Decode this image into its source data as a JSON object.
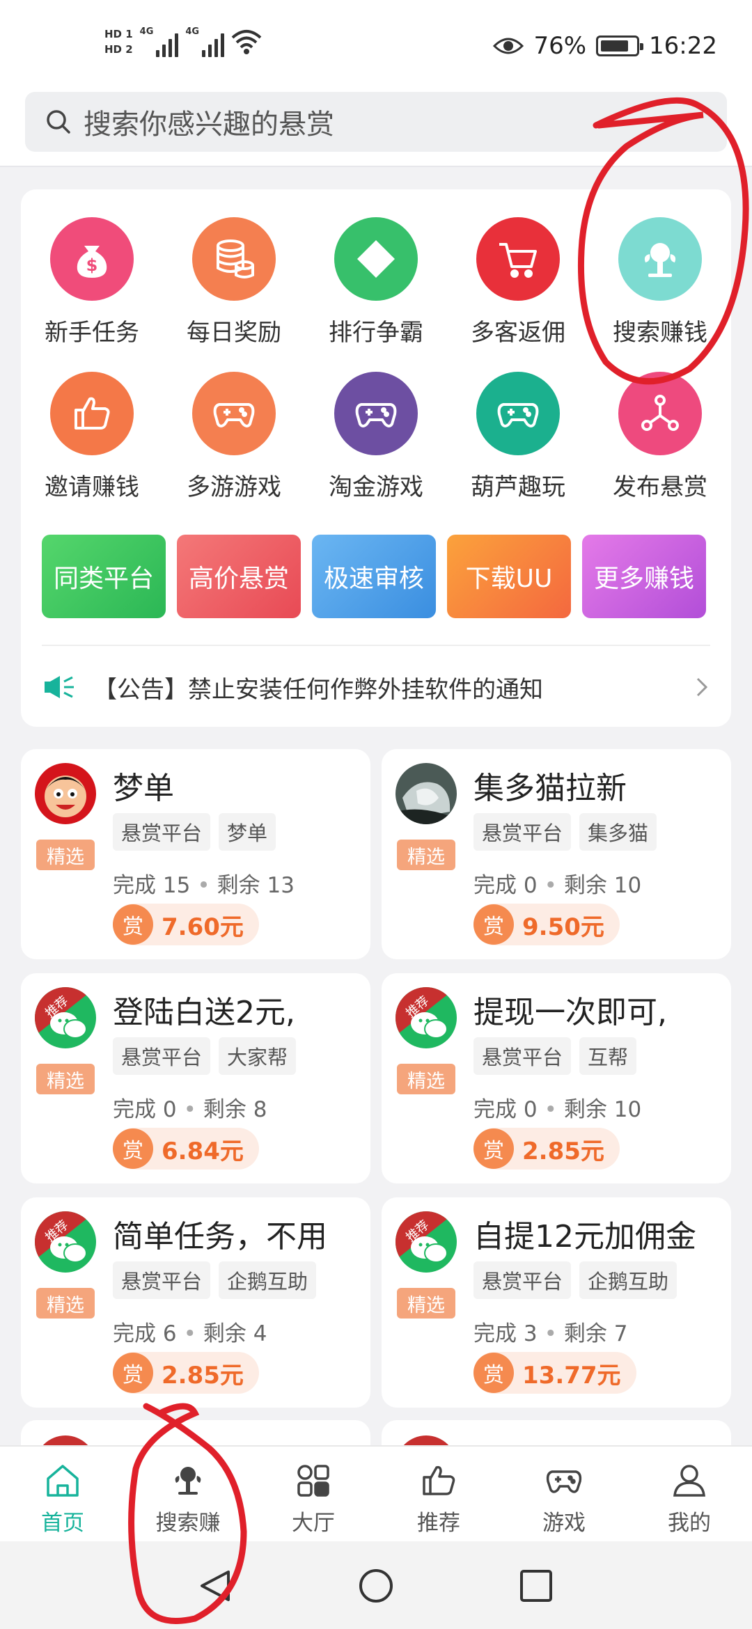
{
  "status_bar": {
    "hd1": "HD 1",
    "hd2": "HD 2",
    "net1": "4G",
    "net2": "4G",
    "battery": "76%",
    "time": "16:22"
  },
  "search": {
    "placeholder": "搜索你感兴趣的悬赏"
  },
  "quick_actions": [
    {
      "label": "新手任务",
      "icon": "money-bag-icon",
      "color": "#f04c7a"
    },
    {
      "label": "每日奖励",
      "icon": "coins-stack-icon",
      "color": "#f47f50"
    },
    {
      "label": "排行争霸",
      "icon": "diamond-icon",
      "color": "#37c06b"
    },
    {
      "label": "多客返佣",
      "icon": "shopping-cart-icon",
      "color": "#e8303a"
    },
    {
      "label": "搜索赚钱",
      "icon": "search-money-icon",
      "color": "#7ddbd1"
    },
    {
      "label": "邀请赚钱",
      "icon": "thumbs-up-icon",
      "color": "#f47848"
    },
    {
      "label": "多游游戏",
      "icon": "gamepad-icon",
      "color": "#f47f50"
    },
    {
      "label": "淘金游戏",
      "icon": "gamepad-icon",
      "color": "#6d4fa2"
    },
    {
      "label": "葫芦趣玩",
      "icon": "gamepad-icon",
      "color": "#1bb08e"
    },
    {
      "label": "发布悬赏",
      "icon": "share-nodes-icon",
      "color": "#ee4a7e"
    }
  ],
  "chips": [
    {
      "label": "同类平台",
      "color": "#3cc760"
    },
    {
      "label": "高价悬赏",
      "color": "#ef5e64"
    },
    {
      "label": "极速审核",
      "color": "#4f9ee8"
    },
    {
      "label": "下载UU",
      "color": "#f6843f"
    },
    {
      "label": "更多赚钱",
      "color": "#c95ae0"
    }
  ],
  "notice": {
    "text": "【公告】禁止安装任何作弊外挂软件的通知"
  },
  "featured_label": "精选",
  "reward_prefix": "赏",
  "tasks": [
    {
      "title": "梦单",
      "tags": [
        "悬赏平台",
        "梦单"
      ],
      "done_label": "完成",
      "done": "15",
      "left_label": "剩余",
      "left": "13",
      "amount": "7.60元",
      "avatar": "cartoon"
    },
    {
      "title": "集多猫拉新",
      "tags": [
        "悬赏平台",
        "集多猫"
      ],
      "done_label": "完成",
      "done": "0",
      "left_label": "剩余",
      "left": "10",
      "amount": "9.50元",
      "avatar": "photo"
    },
    {
      "title": "登陆白送2元,",
      "tags": [
        "悬赏平台",
        "大家帮"
      ],
      "done_label": "完成",
      "done": "0",
      "left_label": "剩余",
      "left": "8",
      "amount": "6.84元",
      "avatar": "wechat"
    },
    {
      "title": "提现一次即可,",
      "tags": [
        "悬赏平台",
        "互帮"
      ],
      "done_label": "完成",
      "done": "0",
      "left_label": "剩余",
      "left": "10",
      "amount": "2.85元",
      "avatar": "wechat"
    },
    {
      "title": "简单任务，不用",
      "tags": [
        "悬赏平台",
        "企鹅互助"
      ],
      "done_label": "完成",
      "done": "6",
      "left_label": "剩余",
      "left": "4",
      "amount": "2.85元",
      "avatar": "wechat"
    },
    {
      "title": "自提12元加佣金",
      "tags": [
        "悬赏平台",
        "企鹅互助"
      ],
      "done_label": "完成",
      "done": "3",
      "left_label": "剩余",
      "left": "7",
      "amount": "13.77元",
      "avatar": "wechat"
    }
  ],
  "recommend_badge": "推荐",
  "tabbar": [
    {
      "label": "首页",
      "icon": "home-icon",
      "active": true
    },
    {
      "label": "搜索赚",
      "icon": "search-money-icon",
      "active": false
    },
    {
      "label": "大厅",
      "icon": "hall-icon",
      "active": false
    },
    {
      "label": "推荐",
      "icon": "thumbs-up-icon",
      "active": false
    },
    {
      "label": "游戏",
      "icon": "gamepad-icon",
      "active": false
    },
    {
      "label": "我的",
      "icon": "profile-icon",
      "active": false
    }
  ],
  "colors": {
    "accent": "#17b39b",
    "reward": "#ef6a2a",
    "annotation": "#e0202a"
  }
}
